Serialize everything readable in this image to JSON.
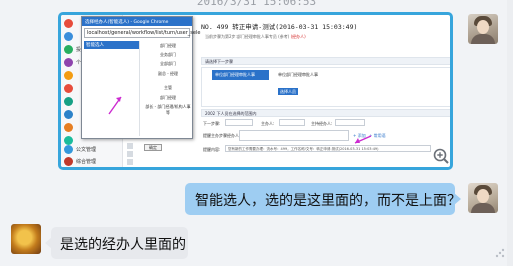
{
  "chat": {
    "timestamp": "2016/3/31 15:06:53",
    "messages": {
      "reply_right": "智能选人，选的是这里面的，而不是上面？",
      "reply_left": "是选的经办人里面的"
    }
  },
  "screenshot": {
    "nav": [
      "投票管理",
      "个人事务"
    ],
    "nav_bottom": [
      "公文管理",
      "综合管理"
    ],
    "popup": {
      "title": "选择经办人(智能选人) - Google Chrome",
      "url": "localhost/general/workflow/list/turn/user_sele",
      "tree": [
        "智能选人"
      ],
      "choices": [
        "部门经理",
        "业务部门",
        "全部部门",
        "副总 - 经理",
        "主管",
        "部门经理",
        "部长 - 部门经理/机构人事等"
      ],
      "confirm": "确定"
    },
    "form": {
      "title": "NO. 499 转正申请-测试(2016-03-31 15:03:49)",
      "subtitle": "当前步骤为第2步:部门经理审批人事专员 (参考)",
      "subtitle_badge": "(经办人)",
      "section1": "请选择下一步骤",
      "step_box": "单位部门经理审批人事",
      "step_label": "单位部门经理审批人事",
      "step_btn": "选择人员",
      "section2": "2002 下人员在选择的范围内",
      "row1": {
        "l1": "下一步骤:",
        "l2": "主办人:",
        "l3": "主持经办人:"
      },
      "row2": {
        "label": "提醒主办步骤经办人",
        "link1": "+ 添加",
        "link2": "+ 常用语"
      },
      "row3": {
        "label": "提醒内容:",
        "value": "您有新的工作需要办理：流水号：499，工作名称/文号：转正申请-测试(2016-03-31 15:03:49)"
      }
    }
  },
  "colors": {
    "image_frame": "#37a5dc",
    "bubble_right": "#9ecdf2",
    "bubble_left": "#e7e9ed",
    "accent": "#2b72c9",
    "annotation_arrow": "#cc2bd0"
  }
}
